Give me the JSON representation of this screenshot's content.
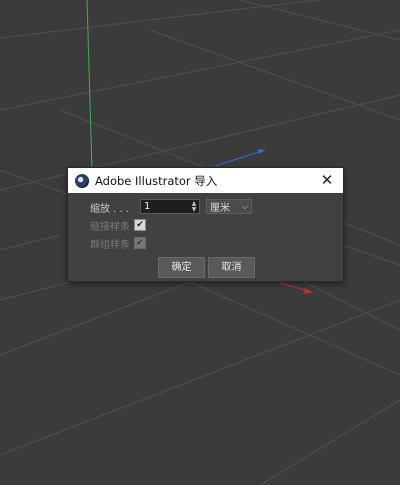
{
  "dialog": {
    "title": "Adobe Illustrator 导入",
    "close_glyph": "✕",
    "scale_label": "缩放 . . .",
    "scale_value": "1",
    "unit_value": "厘米",
    "connect_splines_label": "链接样条",
    "connect_splines_checked": true,
    "group_splines_label": "群组样条",
    "group_splines_checked": true,
    "ok_label": "确定",
    "cancel_label": "取消"
  },
  "icons": {
    "app": "cinema4d-logo-icon",
    "close": "close-icon",
    "dropdown": "chevron-down-icon",
    "check": "checkmark-icon"
  },
  "colors": {
    "background": "#3b3b3b",
    "grid_lines": "#4e4e4e",
    "y_axis": "#3fae5a",
    "x_axis": "#c0392b",
    "z_axis": "#2f6fc9",
    "dialog_bg": "#414141",
    "titlebar_bg": "#ffffff"
  }
}
